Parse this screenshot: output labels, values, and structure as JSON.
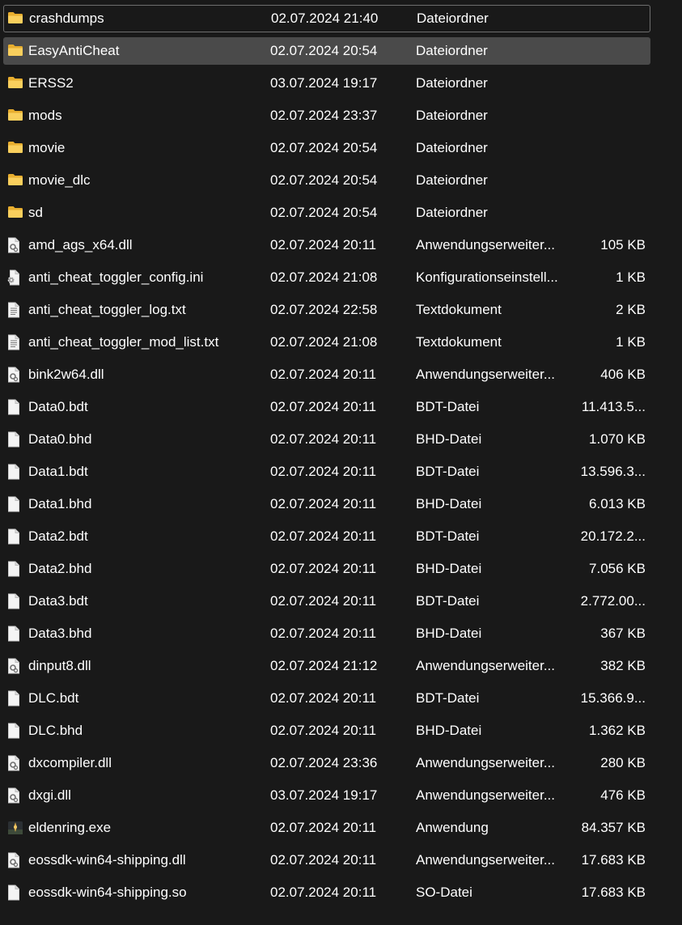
{
  "colors": {
    "background": "#191919",
    "selected_row": "#4a4a4a",
    "focus_border": "#6e6e6e",
    "folder_icon": "#f2c14e",
    "text": "#ffffff"
  },
  "files": [
    {
      "name": "crashdumps",
      "date": "02.07.2024 21:40",
      "type": "Dateiordner",
      "size": "",
      "icon": "folder-icon",
      "focused": true
    },
    {
      "name": "EasyAntiCheat",
      "date": "02.07.2024 20:54",
      "type": "Dateiordner",
      "size": "",
      "icon": "folder-icon",
      "selected": true
    },
    {
      "name": "ERSS2",
      "date": "03.07.2024 19:17",
      "type": "Dateiordner",
      "size": "",
      "icon": "folder-icon"
    },
    {
      "name": "mods",
      "date": "02.07.2024 23:37",
      "type": "Dateiordner",
      "size": "",
      "icon": "folder-icon"
    },
    {
      "name": "movie",
      "date": "02.07.2024 20:54",
      "type": "Dateiordner",
      "size": "",
      "icon": "folder-icon"
    },
    {
      "name": "movie_dlc",
      "date": "02.07.2024 20:54",
      "type": "Dateiordner",
      "size": "",
      "icon": "folder-icon"
    },
    {
      "name": "sd",
      "date": "02.07.2024 20:54",
      "type": "Dateiordner",
      "size": "",
      "icon": "folder-icon"
    },
    {
      "name": "amd_ags_x64.dll",
      "date": "02.07.2024 20:11",
      "type": "Anwendungserweiter...",
      "size": "105 KB",
      "icon": "dll-file-icon"
    },
    {
      "name": "anti_cheat_toggler_config.ini",
      "date": "02.07.2024 21:08",
      "type": "Konfigurationseinstell...",
      "size": "1 KB",
      "icon": "config-file-icon"
    },
    {
      "name": "anti_cheat_toggler_log.txt",
      "date": "02.07.2024 22:58",
      "type": "Textdokument",
      "size": "2 KB",
      "icon": "text-file-icon"
    },
    {
      "name": "anti_cheat_toggler_mod_list.txt",
      "date": "02.07.2024 21:08",
      "type": "Textdokument",
      "size": "1 KB",
      "icon": "text-file-icon"
    },
    {
      "name": "bink2w64.dll",
      "date": "02.07.2024 20:11",
      "type": "Anwendungserweiter...",
      "size": "406 KB",
      "icon": "dll-file-icon"
    },
    {
      "name": "Data0.bdt",
      "date": "02.07.2024 20:11",
      "type": "BDT-Datei",
      "size": "11.413.5...",
      "icon": "file-icon"
    },
    {
      "name": "Data0.bhd",
      "date": "02.07.2024 20:11",
      "type": "BHD-Datei",
      "size": "1.070 KB",
      "icon": "file-icon"
    },
    {
      "name": "Data1.bdt",
      "date": "02.07.2024 20:11",
      "type": "BDT-Datei",
      "size": "13.596.3...",
      "icon": "file-icon"
    },
    {
      "name": "Data1.bhd",
      "date": "02.07.2024 20:11",
      "type": "BHD-Datei",
      "size": "6.013 KB",
      "icon": "file-icon"
    },
    {
      "name": "Data2.bdt",
      "date": "02.07.2024 20:11",
      "type": "BDT-Datei",
      "size": "20.172.2...",
      "icon": "file-icon"
    },
    {
      "name": "Data2.bhd",
      "date": "02.07.2024 20:11",
      "type": "BHD-Datei",
      "size": "7.056 KB",
      "icon": "file-icon"
    },
    {
      "name": "Data3.bdt",
      "date": "02.07.2024 20:11",
      "type": "BDT-Datei",
      "size": "2.772.00...",
      "icon": "file-icon"
    },
    {
      "name": "Data3.bhd",
      "date": "02.07.2024 20:11",
      "type": "BHD-Datei",
      "size": "367 KB",
      "icon": "file-icon"
    },
    {
      "name": "dinput8.dll",
      "date": "02.07.2024 21:12",
      "type": "Anwendungserweiter...",
      "size": "382 KB",
      "icon": "dll-file-icon"
    },
    {
      "name": "DLC.bdt",
      "date": "02.07.2024 20:11",
      "type": "BDT-Datei",
      "size": "15.366.9...",
      "icon": "file-icon"
    },
    {
      "name": "DLC.bhd",
      "date": "02.07.2024 20:11",
      "type": "BHD-Datei",
      "size": "1.362 KB",
      "icon": "file-icon"
    },
    {
      "name": "dxcompiler.dll",
      "date": "02.07.2024 23:36",
      "type": "Anwendungserweiter...",
      "size": "280 KB",
      "icon": "dll-file-icon"
    },
    {
      "name": "dxgi.dll",
      "date": "03.07.2024 19:17",
      "type": "Anwendungserweiter...",
      "size": "476 KB",
      "icon": "dll-file-icon"
    },
    {
      "name": "eldenring.exe",
      "date": "02.07.2024 20:11",
      "type": "Anwendung",
      "size": "84.357 KB",
      "icon": "app-icon"
    },
    {
      "name": "eossdk-win64-shipping.dll",
      "date": "02.07.2024 20:11",
      "type": "Anwendungserweiter...",
      "size": "17.683 KB",
      "icon": "dll-file-icon"
    },
    {
      "name": "eossdk-win64-shipping.so",
      "date": "02.07.2024 20:11",
      "type": "SO-Datei",
      "size": "17.683 KB",
      "icon": "file-icon"
    }
  ]
}
